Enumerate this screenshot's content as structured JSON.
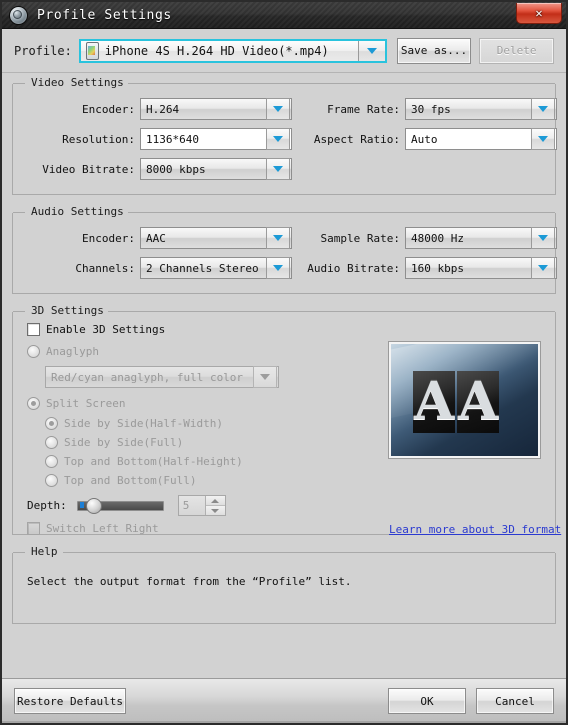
{
  "window": {
    "title": "Profile Settings",
    "app_icon": "globe-disc-icon",
    "close_label": "✕"
  },
  "profile": {
    "label": "Profile:",
    "icon": "iphone-icon",
    "value": "iPhone 4S H.264 HD Video(*.mp4)",
    "save_as_label": "Save as...",
    "delete_label": "Delete"
  },
  "video_settings": {
    "title": "Video Settings",
    "encoder_label": "Encoder:",
    "encoder_value": "H.264",
    "frame_rate_label": "Frame Rate:",
    "frame_rate_value": "30 fps",
    "resolution_label": "Resolution:",
    "resolution_value": "1136*640",
    "aspect_ratio_label": "Aspect Ratio:",
    "aspect_ratio_value": "Auto",
    "video_bitrate_label": "Video Bitrate:",
    "video_bitrate_value": "8000 kbps"
  },
  "audio_settings": {
    "title": "Audio Settings",
    "encoder_label": "Encoder:",
    "encoder_value": "AAC",
    "sample_rate_label": "Sample Rate:",
    "sample_rate_value": "48000 Hz",
    "channels_label": "Channels:",
    "channels_value": "2 Channels Stereo",
    "audio_bitrate_label": "Audio Bitrate:",
    "audio_bitrate_value": "160 kbps"
  },
  "three_d_settings": {
    "title": "3D Settings",
    "enable_label": "Enable 3D Settings",
    "anaglyph_label": "Anaglyph",
    "anaglyph_value": "Red/cyan anaglyph, full color",
    "split_screen_label": "Split Screen",
    "split_options": [
      "Side by Side(Half-Width)",
      "Side by Side(Full)",
      "Top and Bottom(Half-Height)",
      "Top and Bottom(Full)"
    ],
    "depth_label": "Depth:",
    "depth_value": "5",
    "switch_lr_label": "Switch Left Right",
    "learn_more_label": "Learn more about 3D format",
    "preview_glyph_left": "A",
    "preview_glyph_right": "A"
  },
  "help": {
    "title": "Help",
    "text": "Select the output format from the “Profile” list."
  },
  "footer": {
    "restore_label": "Restore Defaults",
    "ok_label": "OK",
    "cancel_label": "Cancel"
  },
  "colors": {
    "accent": "#1c9ad6",
    "focus": "#29c3dd",
    "link": "#2b3ad0",
    "close": "#c32e18",
    "background": "#d2d2d2"
  }
}
